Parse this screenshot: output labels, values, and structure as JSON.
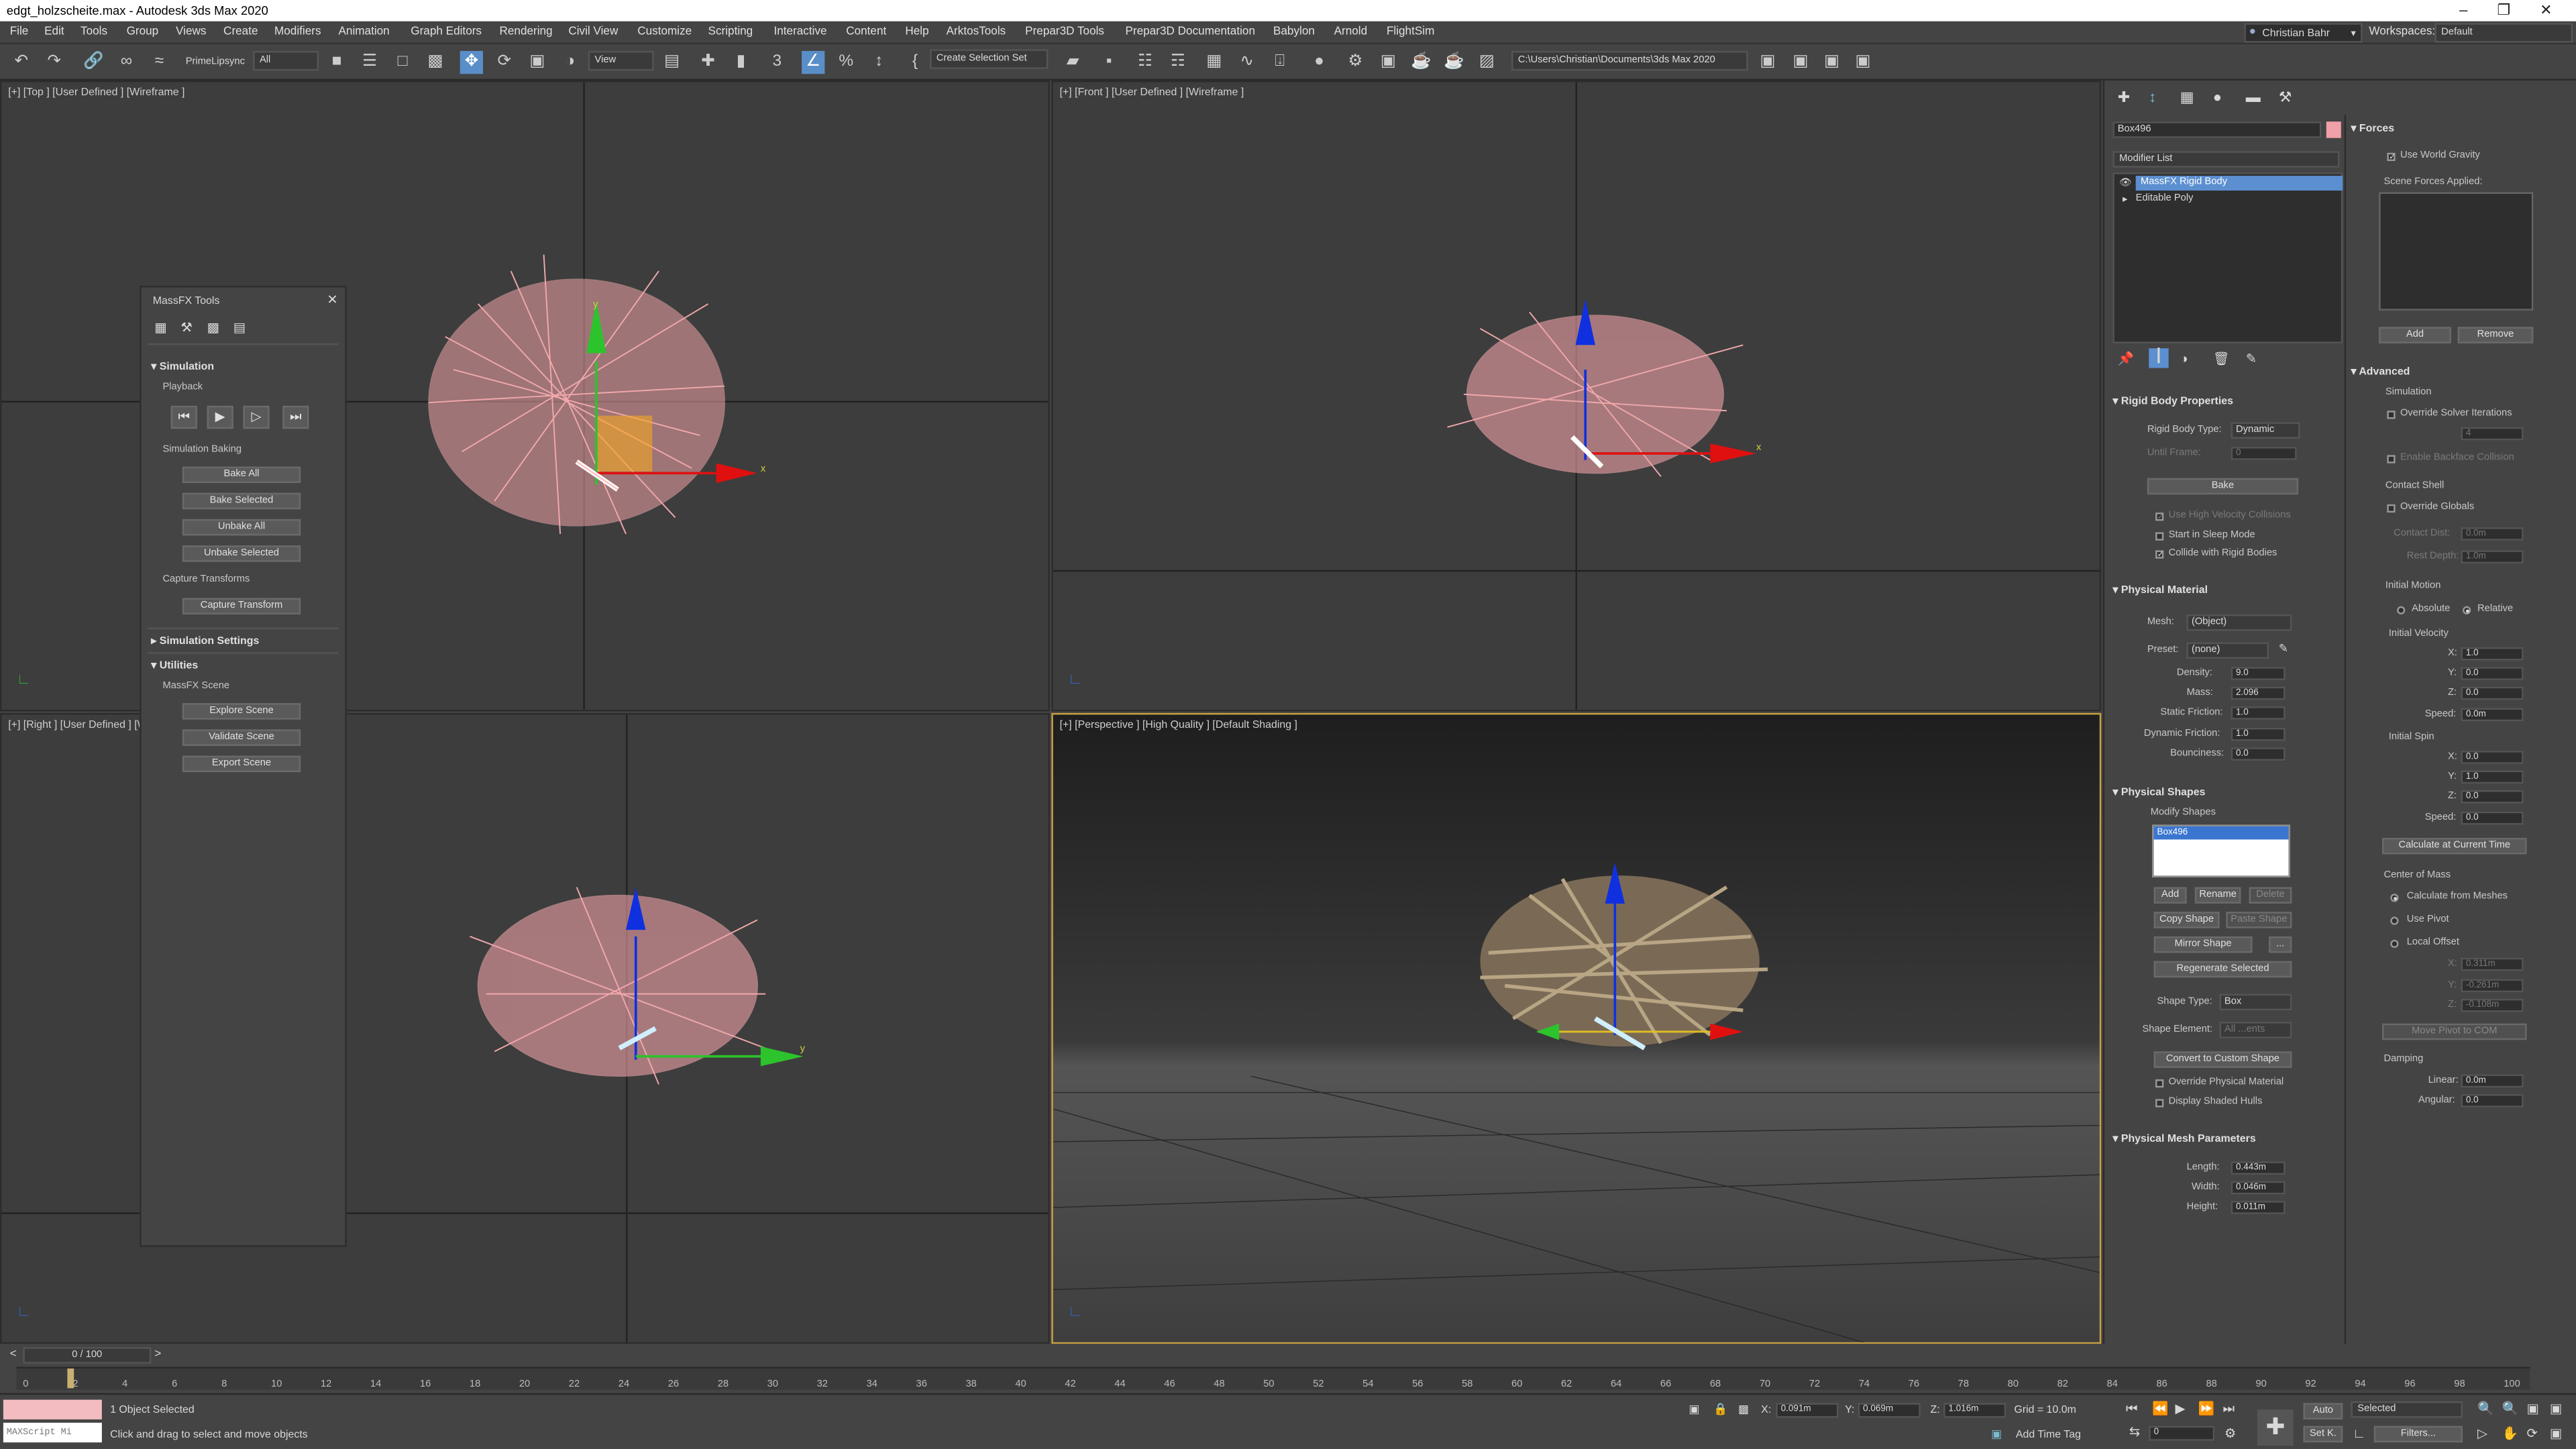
{
  "titlebar": {
    "title": "edgt_holzscheite.max - Autodesk 3ds Max 2020"
  },
  "menu": [
    "File",
    "Edit",
    "Tools",
    "Group",
    "Views",
    "Create",
    "Modifiers",
    "Animation",
    "Graph Editors",
    "Rendering",
    "Civil View",
    "Customize",
    "Scripting",
    "Interactive",
    "Content",
    "Help",
    "ArktosTools",
    "Prepar3D Tools",
    "Prepar3D Documentation",
    "Babylon",
    "Arnold",
    "FlightSim"
  ],
  "user": {
    "name": "Christian Bahr",
    "workspaces_label": "Workspaces:",
    "workspace": "Default"
  },
  "toolbar": {
    "primelipsync": "PrimeLipsync",
    "filter": "All",
    "view": "View",
    "selection_set": "Create Selection Set",
    "path": "C:\\Users\\Christian\\Documents\\3ds Max 2020"
  },
  "viewports": {
    "top": "[+] [Top ] [User Defined ] [Wireframe ]",
    "front": "[+] [Front ] [User Defined ] [Wireframe ]",
    "right": "[+] [Right ] [User Defined ] [Wireframe ]",
    "perspective": "[+] [Perspective ] [High Quality ] [Default Shading ]"
  },
  "massfx": {
    "title": "MassFX Tools",
    "simulation": "Simulation",
    "playback": "Playback",
    "baking": "Simulation Baking",
    "bake_all": "Bake All",
    "bake_selected": "Bake Selected",
    "unbake_all": "Unbake All",
    "unbake_selected": "Unbake Selected",
    "capture": "Capture Transforms",
    "capture_btn": "Capture Transform",
    "sim_settings": "Simulation Settings",
    "utilities": "Utilities",
    "scene": "MassFX Scene",
    "explore": "Explore Scene",
    "validate": "Validate Scene",
    "export": "Export Scene"
  },
  "modify": {
    "object_name": "Box496",
    "modifier_list": "Modifier List",
    "stack": [
      "MassFX Rigid Body",
      "Editable Poly"
    ],
    "rbp": "Rigid Body Properties",
    "rb_type_label": "Rigid Body Type:",
    "rb_type": "Dynamic",
    "until_frame_label": "Until Frame:",
    "until_frame": "0",
    "bake": "Bake",
    "use_hv": "Use High Velocity Collisions",
    "sleep": "Start in Sleep Mode",
    "collide": "Collide with Rigid Bodies",
    "pm": "Physical Material",
    "mesh_label": "Mesh:",
    "mesh": "(Object)",
    "preset_label": "Preset:",
    "preset": "(none)",
    "density_label": "Density:",
    "density": "9.0",
    "mass_label": "Mass:",
    "mass": "2.096",
    "sf_label": "Static Friction:",
    "sf": "1.0",
    "df_label": "Dynamic Friction:",
    "df": "1.0",
    "bounce_label": "Bounciness:",
    "bounce": "0.0",
    "ps": "Physical Shapes",
    "modify_shapes": "Modify Shapes",
    "shape_item": "Box496",
    "add": "Add",
    "rename": "Rename",
    "delete": "Delete",
    "copy_shape": "Copy Shape",
    "paste_shape": "Paste Shape",
    "mirror_shape": "Mirror Shape",
    "more": "...",
    "regenerate": "Regenerate Selected",
    "shape_type_label": "Shape Type:",
    "shape_type": "Box",
    "shape_elem_label": "Shape Element:",
    "shape_elem": "All ...ents",
    "convert": "Convert to Custom Shape",
    "override_pm": "Override Physical Material",
    "display_hulls": "Display Shaded Hulls",
    "pmp": "Physical Mesh Parameters",
    "length_label": "Length:",
    "length": "0.443m",
    "width_label": "Width:",
    "width": "0.046m",
    "height_label": "Height:",
    "height": "0.011m"
  },
  "forces": {
    "title": "Forces",
    "world_gravity": "Use World Gravity",
    "applied": "Scene Forces Applied:",
    "add": "Add",
    "remove": "Remove",
    "advanced": "Advanced",
    "simulation": "Simulation",
    "override_solver": "Override Solver Iterations",
    "solver_val": "4",
    "backface": "Enable Backface Collision",
    "contact_shell": "Contact Shell",
    "override_globals": "Override Globals",
    "contact_dist_label": "Contact Dist:",
    "contact_dist": "0.0m",
    "rest_depth_label": "Rest Depth:",
    "rest_depth": "1.0m",
    "initial_motion": "Initial Motion",
    "absolute": "Absolute",
    "relative": "Relative",
    "init_vel": "Initial Velocity",
    "vx": "1.0",
    "vy": "0.0",
    "vz": "0.0",
    "vspeed": "0.0m",
    "init_spin": "Initial Spin",
    "sx": "0.0",
    "sy": "1.0",
    "sz": "0.0",
    "sspeed": "0.0",
    "calc_current": "Calculate at Current Time",
    "com": "Center of Mass",
    "calc_meshes": "Calculate from Meshes",
    "use_pivot": "Use Pivot",
    "local_offset": "Local Offset",
    "ox": "0.311m",
    "oy": "-0.261m",
    "oz": "-0.108m",
    "move_pivot": "Move Pivot to COM",
    "damping": "Damping",
    "linear_label": "Linear:",
    "linear": "0.0m",
    "angular_label": "Angular:",
    "angular": "0.0",
    "x": "X:",
    "y": "Y:",
    "z": "Z:",
    "speed": "Speed:"
  },
  "timeline": {
    "frame": "0 / 100",
    "ticks": [
      "0",
      "2",
      "4",
      "6",
      "8",
      "10",
      "12",
      "14",
      "16",
      "18",
      "20",
      "22",
      "24",
      "26",
      "28",
      "30",
      "32",
      "34",
      "36",
      "38",
      "40",
      "42",
      "44",
      "46",
      "48",
      "50",
      "52",
      "54",
      "56",
      "58",
      "60",
      "62",
      "64",
      "66",
      "68",
      "70",
      "72",
      "74",
      "76",
      "78",
      "80",
      "82",
      "84",
      "86",
      "88",
      "90",
      "92",
      "94",
      "96",
      "98",
      "100"
    ]
  },
  "status": {
    "maxscript": "MAXScript Mi",
    "selected": "1 Object Selected",
    "hint": "Click and drag to select and move objects",
    "x": "0.091m",
    "y": "0.069m",
    "z": "1.016m",
    "grid": "Grid = 10.0m",
    "add_time_tag": "Add Time Tag",
    "auto": "Auto",
    "setk": "Set K.",
    "sel_mode": "Selected",
    "filters": "Filters...",
    "frame": "0"
  }
}
